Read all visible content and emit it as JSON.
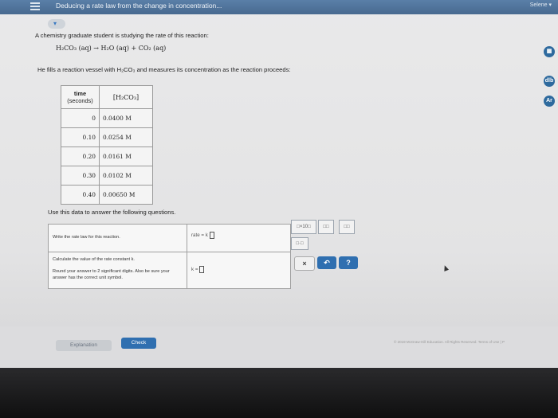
{
  "topbar": {
    "title": "Deducing a rate law from the change in concentration...",
    "right": "Selene ▾"
  },
  "collapse_chevron": "▾",
  "problem": {
    "intro": "A chemistry graduate student is studying the rate of this reaction:",
    "reaction": "H₂CO₃ (aq) → H₂O (aq) + CO₂ (aq)",
    "setup": "He fills a reaction vessel with H₂CO₃ and measures its concentration as the reaction proceeds:"
  },
  "table": {
    "header_time": [
      "time",
      "(seconds)"
    ],
    "header_conc": "[H₂CO₃]",
    "rows": [
      {
        "t": "0",
        "c": "0.0400 M"
      },
      {
        "t": "0.10",
        "c": "0.0254 M"
      },
      {
        "t": "0.20",
        "c": "0.0161 M"
      },
      {
        "t": "0.30",
        "c": "0.0102 M"
      },
      {
        "t": "0.40",
        "c": "0.00650 M"
      }
    ]
  },
  "use_data": "Use this data to answer the following questions.",
  "questions": {
    "q1": "Write the rate law for this reaction.",
    "q2": "Calculate the value of the rate constant k.",
    "q3": "Round your answer to 2 significant digits. Also be sure your answer has the correct unit symbol.",
    "a1": "rate = k",
    "a2": "k ="
  },
  "tools": {
    "t1": "□×10□",
    "t2": "□□",
    "t3": "□□",
    "t4": "□·□"
  },
  "buttons": {
    "clear": "×",
    "undo": "↶",
    "help": "?"
  },
  "footer": {
    "explanation": "Explanation",
    "check": "Check",
    "copyright": "© 2019 McGraw-Hill Education. All Rights Reserved. Terms of Use | P"
  },
  "side": {
    "calc": "▦",
    "chart": "dlb",
    "ref": "Ar"
  }
}
